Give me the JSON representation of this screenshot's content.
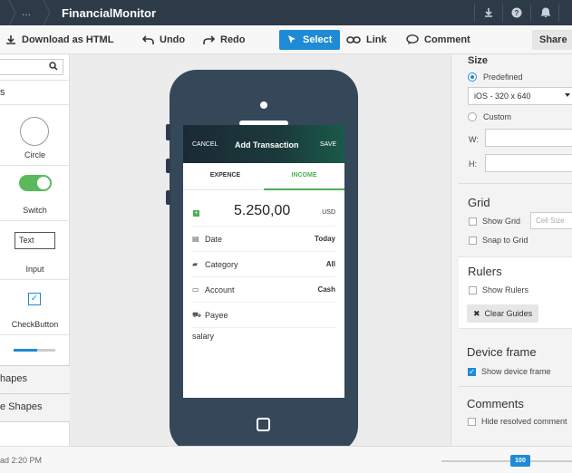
{
  "topbar": {
    "breadcrumb_dots": "...",
    "title": "FinancialMonitor"
  },
  "toolbar": {
    "download_label": "Download as HTML",
    "undo_label": "Undo",
    "redo_label": "Redo",
    "select_label": "Select",
    "link_label": "Link",
    "comment_label": "Comment",
    "share_label": "Share"
  },
  "left_panel": {
    "section_label": "s",
    "items": [
      {
        "label": "Circle"
      },
      {
        "label": "Switch"
      },
      {
        "label": "Input",
        "preview": "Text"
      },
      {
        "label": "CheckButton"
      }
    ],
    "section_shapes": "hapes",
    "section_more_shapes": "e Shapes"
  },
  "phone_screen": {
    "cancel": "CANCEL",
    "title": "Add Transaction",
    "save": "SAVE",
    "tab_expence": "EXPENCE",
    "tab_income": "INCOME",
    "amount": "5.250,00",
    "currency": "USD",
    "rows": [
      {
        "label": "Date",
        "value": "Today",
        "icon": "calendar-icon"
      },
      {
        "label": "Category",
        "value": "All",
        "icon": "folder-icon"
      },
      {
        "label": "Account",
        "value": "Cash",
        "icon": "card-icon"
      },
      {
        "label": "Payee",
        "value": "",
        "icon": "cart-icon"
      }
    ],
    "note": "salary"
  },
  "right_panel": {
    "size_heading": "Size",
    "predefined_label": "Predefined",
    "device_select": "iOS  -  320 x 640",
    "custom_label": "Custom",
    "w_label": "W:",
    "h_label": "H:",
    "grid_heading": "Grid",
    "show_grid_label": "Show Grid",
    "cell_size_placeholder": "Cell Size",
    "snap_label": "Snap to Grid",
    "rulers_heading": "Rulers",
    "show_rulers_label": "Show Rulers",
    "clear_guides_label": "Clear Guides",
    "device_frame_heading": "Device frame",
    "show_device_frame_label": "Show device frame",
    "comments_heading": "Comments",
    "hide_resolved_label": "Hide resolved comment"
  },
  "statusbar": {
    "saved_text": "ad 2:20 PM",
    "zoom": "100"
  },
  "colors": {
    "topbar": "#2d3a48",
    "accent": "#1e8bd6",
    "phone_body": "#34485a",
    "income_green": "#4caf50"
  }
}
